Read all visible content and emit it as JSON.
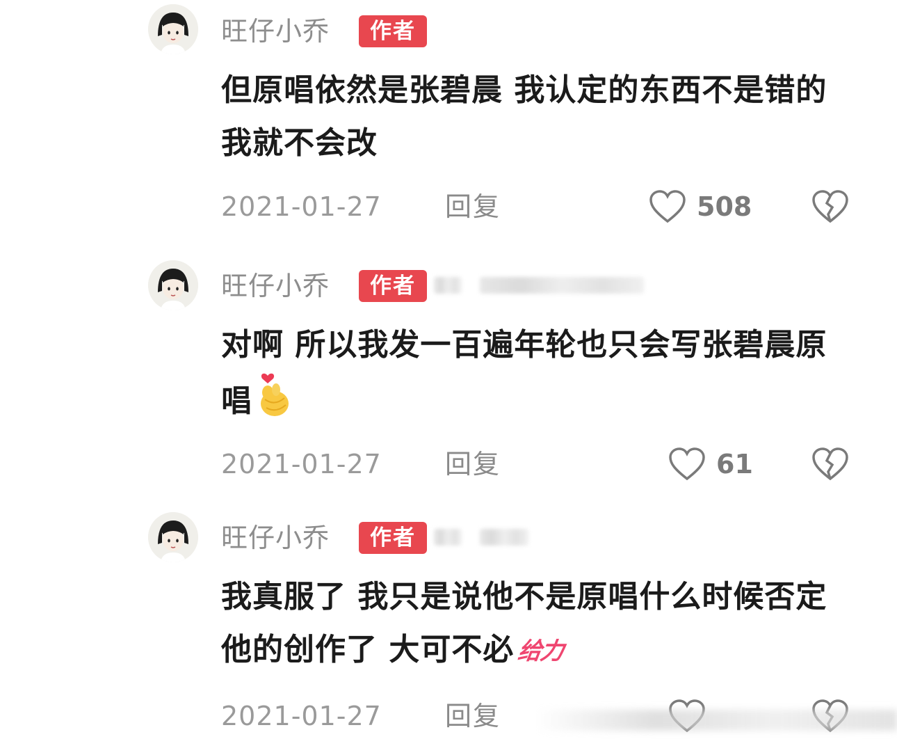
{
  "comments": [
    {
      "username": "旺仔小乔",
      "badge": "作者",
      "text": "但原唱依然是张碧晨 我认定的东西不是错的我就不会改",
      "date": "2021-01-27",
      "reply_label": "回复",
      "likes": "508",
      "emoji": ""
    },
    {
      "username": "旺仔小乔",
      "badge": "作者",
      "text": "对啊 所以我发一百遍年轮也只会写张碧晨原唱",
      "date": "2021-01-27",
      "reply_label": "回复",
      "likes": "61",
      "emoji": "finger-heart-emoji"
    },
    {
      "username": "旺仔小乔",
      "badge": "作者",
      "text": "我真服了 我只是说他不是原唱什么时候否定他的创作了 大可不必",
      "sticker": "给力",
      "date": "2021-01-27",
      "reply_label": "回复",
      "likes": "",
      "emoji": ""
    }
  ],
  "colors": {
    "badge_bg": "#e8474f",
    "username": "#8d8d8d",
    "meta": "#9a9a9a",
    "sticker": "#ef4670"
  }
}
